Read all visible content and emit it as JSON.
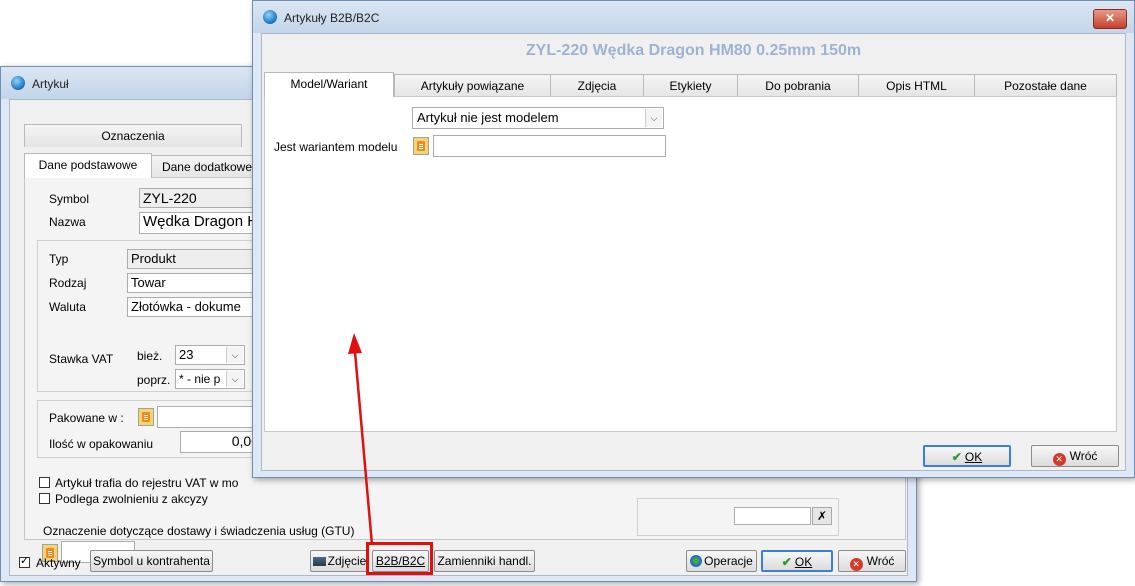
{
  "back_window": {
    "title": "Artykuł",
    "tabs_row1": [
      "Oznaczenia"
    ],
    "tabs_row2": [
      "Dane podstawowe",
      "Dane dodatkowe"
    ],
    "symbol_label": "Symbol",
    "symbol_value": "ZYL-220",
    "nazwa_label": "Nazwa",
    "nazwa_value": "Wędka Dragon H",
    "typ_label": "Typ",
    "typ_value": "Produkt",
    "rodzaj_label": "Rodzaj",
    "rodzaj_value": "Towar",
    "waluta_label": "Waluta",
    "waluta_value": "Złotówka - dokume",
    "vat_label": "Stawka VAT",
    "biez_label": "bież.",
    "biez_value": "23",
    "poprz_label": "poprz.",
    "poprz_value": "* - nie p",
    "pakowane_label": "Pakowane w :",
    "ilosc_label": "Ilość w opakowaniu",
    "ilosc_value": "0,00",
    "check_vat_label": "Artykuł trafia do rejestru VAT w mo",
    "check_akcyza_label": "Podlega zwolnieniu z akcyzy",
    "gtu_label": "Oznaczenie dotyczące dostawy i świadczenia usług (GTU)",
    "aktywny_label": "Aktywny",
    "buttons": {
      "symbol_kontrahenta": "Symbol u kontrahenta",
      "zdjecie": "Zdjęcie",
      "b2b": "B2B/B2C",
      "zamienniki": "Zamienniki handl.",
      "operacje": "Operacje",
      "ok": "OK",
      "wroc": "Wróć"
    }
  },
  "front_window": {
    "title": "Artykuły B2B/B2C",
    "header": "ZYL-220  Wędka Dragon HM80 0.25mm 150m",
    "tabs": [
      "Model/Wariant",
      "Artykuły powiązane",
      "Zdjęcia",
      "Etykiety",
      "Do pobrania",
      "Opis HTML",
      "Pozostałe dane"
    ],
    "model_combo_value": "Artykuł nie jest modelem",
    "wariant_label": "Jest wariantem modelu",
    "wariant_value": "",
    "ok": "OK",
    "wroc": "Wróć",
    "close_glyph": "✕"
  },
  "colors": {
    "header_text": "#9db3d3",
    "highlight_box": "#e01010",
    "arrow": "#e01010",
    "title_gradient_top": "#dbe6f3",
    "frame": "#f0f0f0"
  }
}
